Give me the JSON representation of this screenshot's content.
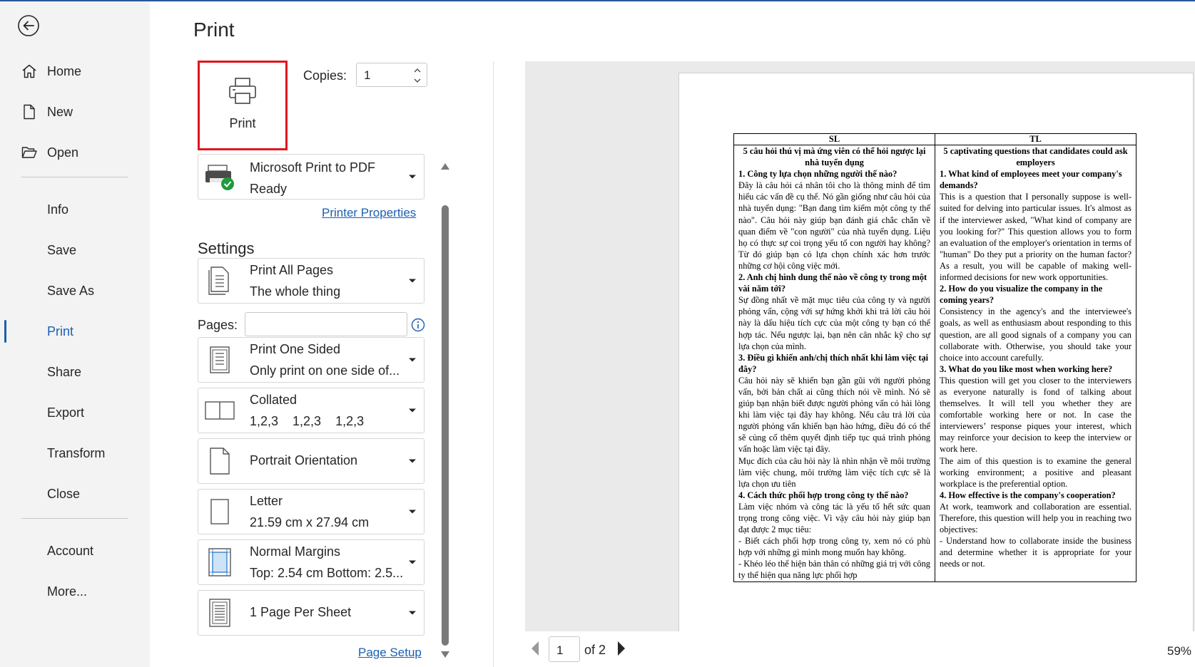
{
  "sidebar": {
    "items": [
      {
        "label": "Home"
      },
      {
        "label": "New"
      },
      {
        "label": "Open"
      },
      {
        "label": "Info"
      },
      {
        "label": "Save"
      },
      {
        "label": "Save As"
      },
      {
        "label": "Print"
      },
      {
        "label": "Share"
      },
      {
        "label": "Export"
      },
      {
        "label": "Transform"
      },
      {
        "label": "Close"
      },
      {
        "label": "Account"
      },
      {
        "label": "More..."
      }
    ],
    "active": "Print"
  },
  "main": {
    "title": "Print",
    "print_button": "Print",
    "copies_label": "Copies:",
    "copies_value": "1",
    "printer": {
      "name": "Microsoft Print to PDF",
      "status": "Ready"
    },
    "printer_properties": "Printer Properties",
    "settings_heading": "Settings",
    "pages_label": "Pages:",
    "pages_value": "",
    "page_setup": "Page Setup",
    "settings": [
      {
        "line1": "Print All Pages",
        "line2": "The whole thing"
      },
      {
        "line1": "Print One Sided",
        "line2": "Only print on one side of..."
      },
      {
        "line1": "Collated",
        "line2": "1,2,3    1,2,3    1,2,3"
      },
      {
        "line1": "Portrait Orientation",
        "line2": ""
      },
      {
        "line1": "Letter",
        "line2": "21.59 cm x 27.94 cm"
      },
      {
        "line1": "Normal Margins",
        "line2": "Top: 2.54 cm Bottom: 2.5..."
      },
      {
        "line1": "1 Page Per Sheet",
        "line2": ""
      }
    ]
  },
  "preview": {
    "current_page": "1",
    "of_pages": "of 2",
    "zoom": "59%",
    "doc": {
      "col_left_header": "SL",
      "col_right_header": "TL",
      "left": {
        "caption": "5 câu hỏi thú vị mà ứng viên có thể hỏi ngược lại nhà tuyển dụng",
        "q1": "1. Công ty lựa chọn những người thế nào?",
        "p1": "Đây là câu hỏi cá nhân tôi cho là thông minh để tìm hiểu các vấn đề cụ thể. Nó gần giống như câu hỏi của nhà tuyển dụng: \"Bạn đang tìm kiếm một công ty thế nào\". Câu hỏi này giúp bạn đánh giá chắc chắn về quan điểm về \"con người\" của nhà tuyển dụng. Liệu họ có thực sự coi trọng yếu tố con người hay không? Từ đó giúp bạn có lựa chọn chính xác hơn trước những cơ hội công việc mới.",
        "q2": "2. Anh chị hình dung thế nào về công ty trong một vài năm tới?",
        "p2": "Sự đồng nhất về mặt mục tiêu của công ty và người phỏng vấn, cộng với sự hứng khởi khi trả lời câu hỏi này là dấu hiệu tích cực của một công ty bạn có thể hợp tác. Nếu ngược lại, bạn nên cân nhắc kỹ cho sự lựa chọn của mình.",
        "q3": "3. Điều gì khiến anh/chị thích nhất khi làm việc tại đây?",
        "p3": "Câu hỏi này sẽ khiến bạn gần gũi với người phỏng vấn, bởi bản chất ai cũng thích nói về mình. Nó sẽ giúp bạn nhận biết được người phỏng vấn có hài lòng khi làm việc tại đây hay không. Nếu câu trả lời của người phỏng vấn khiến bạn hào hứng, điều đó có thể sẽ củng cố thêm quyết định tiếp tục quá trình phỏng vấn hoặc làm việc tại đây.",
        "p3b": "Mục đích của câu hỏi này là nhìn nhận về môi trường làm việc chung, môi trường làm việc tích cực sẽ là lựa chọn ưu tiên",
        "q4": "4. Cách thức phối hợp trong công ty thế nào?",
        "p4": "Làm việc nhóm và công tác là yếu tố hết sức quan trọng trong công việc. Vì vậy câu hỏi này giúp bạn đạt được 2 mục tiêu:",
        "p4b": "- Biết cách phối hợp trong công ty, xem nó có phù hợp với những gì mình mong muốn hay không.",
        "p4c": "- Khéo léo thể hiện bản thân có những giá trị với công ty thể hiện qua năng lực phối hợp"
      },
      "right": {
        "caption": "5 captivating questions that candidates could ask employers",
        "q1": "1. What kind of employees meet your company's demands?",
        "p1": "This is a question that I personally suppose is well-suited for delving into particular issues. It's almost as if the interviewer asked, \"What kind of company are you looking for?\" This question allows you to form an evaluation of the employer's orientation in terms of \"human\" Do they put a priority on the human factor? As a result, you will be capable of making well-informed decisions for new work opportunities.",
        "q2": "2. How do you visualize the company in the coming years?",
        "p2": "Consistency in the agency's and the interviewee's goals, as well as enthusiasm about responding to this question, are all good signals of a company you can collaborate with. Otherwise, you should take your choice into account carefully.",
        "q3": "3. What do you like most when working here?",
        "p3": "This question will get you closer to the interviewers as everyone naturally is fond of talking about themselves. It will tell you whether they are comfortable working here or not. In case the interviewers’ response piques your interest, which may reinforce your decision to keep the interview or work here.",
        "p3b": "The aim of this question is to examine the general working environment; a positive and pleasant workplace is the preferential option.",
        "q4": "4. How effective is the company's cooperation?",
        "p4": "At work, teamwork and collaboration are essential. Therefore, this question will help you in reaching two objectives:",
        "p4b": "- Understand how to collaborate inside the business and determine whether it is appropriate for your needs or not."
      }
    }
  }
}
